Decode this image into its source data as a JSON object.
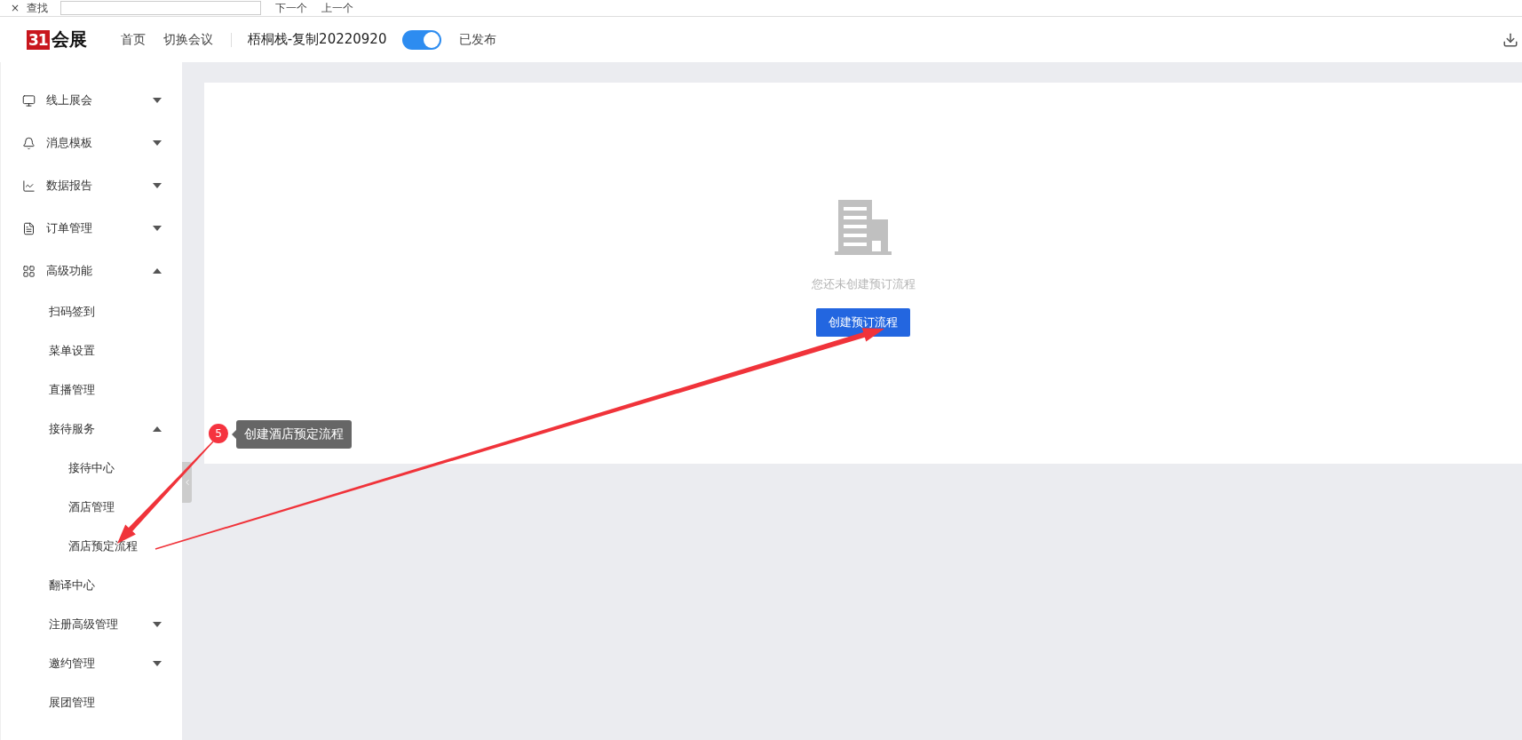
{
  "find_bar": {
    "close": "×",
    "label": "查找",
    "next": "下一个",
    "previous": "上一个"
  },
  "header": {
    "logo_mark": "31",
    "logo_text": "会展",
    "nav": [
      "首页",
      "切换会议"
    ],
    "event_title": "梧桐栈-复制20220920",
    "published": {
      "on": true,
      "label": "已发布"
    }
  },
  "sidebar": {
    "items": [
      {
        "label": "线上展会",
        "expanded": false
      },
      {
        "label": "消息模板",
        "expanded": false
      },
      {
        "label": "数据报告",
        "expanded": false
      },
      {
        "label": "订单管理",
        "expanded": false
      },
      {
        "label": "高级功能",
        "expanded": true,
        "children": [
          {
            "label": "扫码签到"
          },
          {
            "label": "菜单设置"
          },
          {
            "label": "直播管理"
          },
          {
            "label": "接待服务",
            "expanded": true,
            "children": [
              {
                "label": "接待中心"
              },
              {
                "label": "酒店管理"
              },
              {
                "label": "酒店预定流程"
              }
            ]
          },
          {
            "label": "翻译中心"
          },
          {
            "label": "注册高级管理",
            "expanded": false
          },
          {
            "label": "邀约管理",
            "expanded": false
          },
          {
            "label": "展团管理"
          }
        ]
      }
    ]
  },
  "empty_state": {
    "message": "您还未创建预订流程",
    "button": "创建预订流程"
  },
  "annotation": {
    "step": "5",
    "tooltip": "创建酒店预定流程"
  }
}
